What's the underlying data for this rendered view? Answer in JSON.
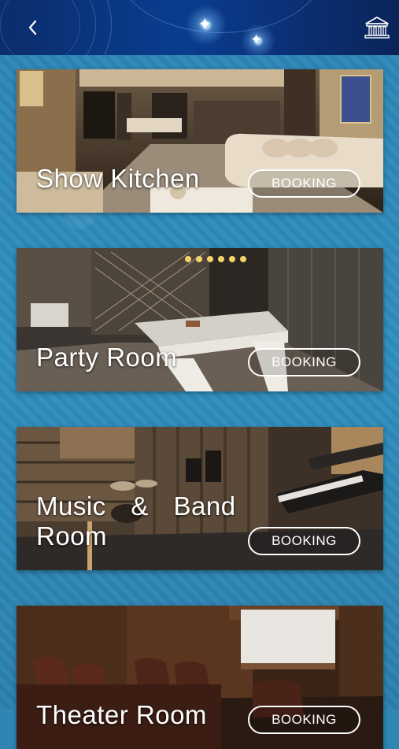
{
  "header": {
    "back_icon": "chevron-left-icon",
    "home_icon": "building-home-icon"
  },
  "cards": [
    {
      "title": "Show Kitchen",
      "button": "BOOKING"
    },
    {
      "title": "Party Room",
      "button": "BOOKING"
    },
    {
      "title_line1": "Music & Band",
      "title_line2": "Room",
      "button": "BOOKING"
    },
    {
      "title": "Theater Room",
      "button": "BOOKING"
    }
  ]
}
